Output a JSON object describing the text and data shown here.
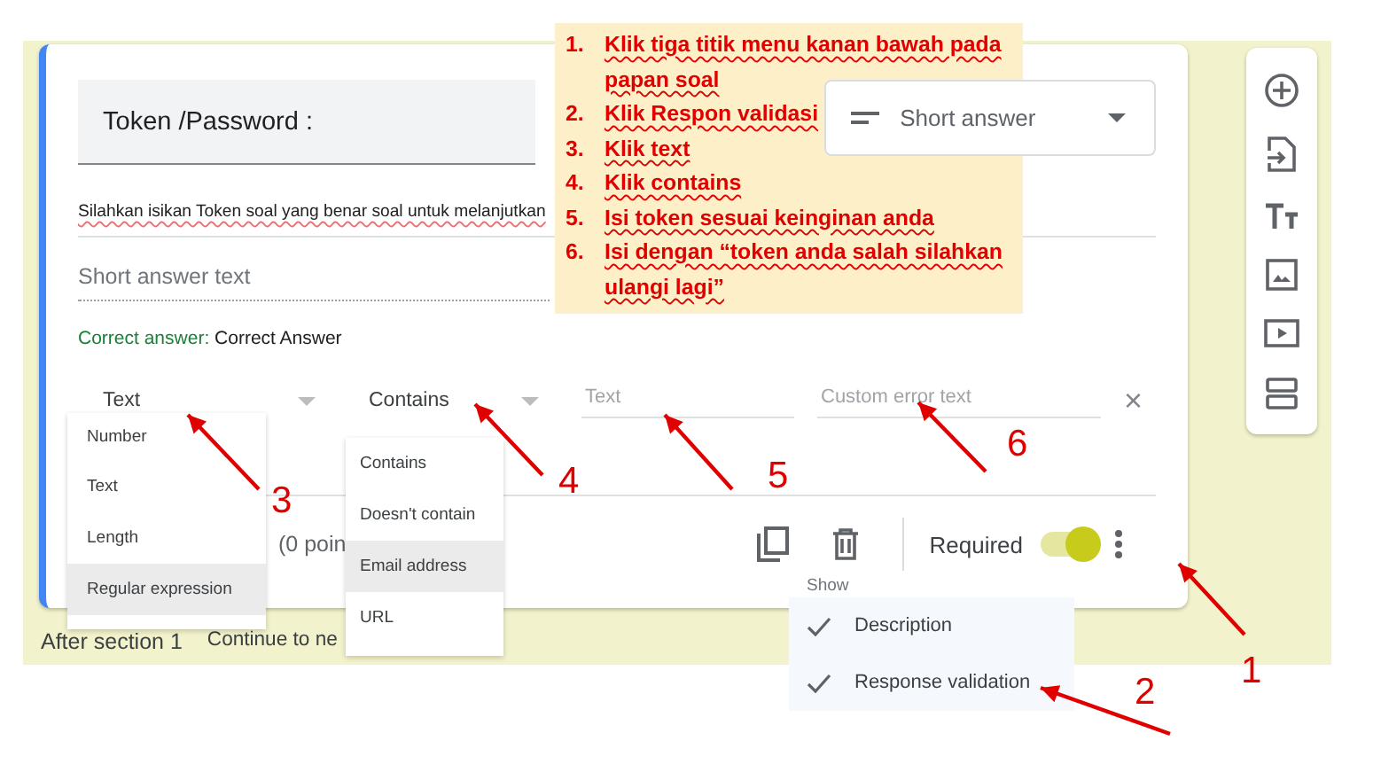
{
  "question": {
    "title": "Token /Password :",
    "type": "Short answer",
    "description": "Silahkan isikan Token soal yang benar soal untuk melanjutkan",
    "answer_placeholder": "Short answer text",
    "correct_answer_label": "Correct answer:",
    "correct_answer": "Correct Answer"
  },
  "validation": {
    "type_select": "Text",
    "condition_select": "Contains",
    "value_placeholder": "Text",
    "error_placeholder": "Custom error text",
    "clear": "×"
  },
  "footer": {
    "points": "(0 poin",
    "required_label": "Required",
    "required": true
  },
  "after_section": {
    "label": "After section 1",
    "action": "Continue to ne"
  },
  "type_menu": [
    {
      "label": "Number",
      "selected": false
    },
    {
      "label": "Text",
      "selected": false
    },
    {
      "label": "Length",
      "selected": false
    },
    {
      "label": "Regular expression",
      "selected": true
    }
  ],
  "condition_menu": [
    {
      "label": "Contains",
      "selected": false
    },
    {
      "label": "Doesn't contain",
      "selected": false
    },
    {
      "label": "Email address",
      "selected": true
    },
    {
      "label": "URL",
      "selected": false
    }
  ],
  "show_menu": {
    "title": "Show",
    "items": [
      {
        "label": "Description",
        "checked": true
      },
      {
        "label": "Response validation",
        "checked": true
      }
    ]
  },
  "instructions": [
    {
      "number": "1.",
      "text": "Klik tiga titik menu kanan bawah pada papan soal"
    },
    {
      "number": "2.",
      "text": "Klik Respon validasi"
    },
    {
      "number": "3.",
      "text": "Klik text"
    },
    {
      "number": "4.",
      "text": "Klik contains"
    },
    {
      "number": "5.",
      "text": "Isi token sesuai keinginan anda"
    },
    {
      "number": "6.",
      "text": "Isi dengan “token anda salah silahkan ulangi lagi”"
    }
  ],
  "callouts": [
    "1",
    "2",
    "3",
    "4",
    "5",
    "6"
  ]
}
